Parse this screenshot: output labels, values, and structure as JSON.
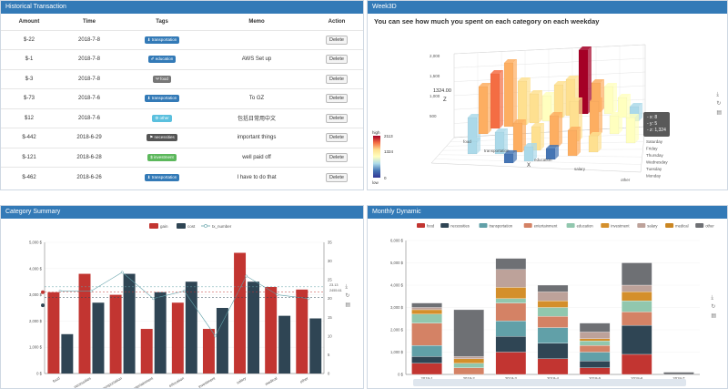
{
  "history": {
    "title": "Historical Transaction",
    "columns": [
      "Amount",
      "Time",
      "Tags",
      "Memo",
      "Action"
    ],
    "rows": [
      {
        "amount": "$-22",
        "time": "2018-7-8",
        "tag": "transportation",
        "tag_icon": "⬇",
        "tag_color": "#337ab7",
        "memo": "",
        "action": "Delete"
      },
      {
        "amount": "$-1",
        "time": "2018-7-8",
        "tag": "education",
        "tag_icon": "✐",
        "tag_color": "#337ab7",
        "memo": "AWS Set up",
        "action": "Delete"
      },
      {
        "amount": "$-3",
        "time": "2018-7-8",
        "tag": "food",
        "tag_icon": "Ψ",
        "tag_color": "#777777",
        "memo": "",
        "action": "Delete"
      },
      {
        "amount": "$-73",
        "time": "2018-7-6",
        "tag": "transportation",
        "tag_icon": "⬇",
        "tag_color": "#337ab7",
        "memo": "To GZ",
        "action": "Delete"
      },
      {
        "amount": "$12",
        "time": "2018-7-6",
        "tag": "other",
        "tag_icon": "⚙",
        "tag_color": "#5bc0de",
        "memo": "包括日常用中文",
        "action": "Delete"
      },
      {
        "amount": "$-442",
        "time": "2018-6-29",
        "tag": "necessities",
        "tag_icon": "⚑",
        "tag_color": "#555555",
        "memo": "important things",
        "action": "Delete"
      },
      {
        "amount": "$-121",
        "time": "2018-6-28",
        "tag": "investment",
        "tag_icon": "$",
        "tag_color": "#5cb85c",
        "memo": "well paid off",
        "action": "Delete"
      },
      {
        "amount": "$-462",
        "time": "2018-6-26",
        "tag": "transportation",
        "tag_icon": "⬇",
        "tag_color": "#337ab7",
        "memo": "I have to do that",
        "action": "Delete"
      }
    ]
  },
  "week3d": {
    "title": "Week3D",
    "subtitle": "You can see how much you spent on each category on each weekday",
    "visual_map": {
      "high_label": "high",
      "low_label": "low",
      "max": "2113",
      "mid": "1324",
      "min": "0"
    },
    "z_axis": {
      "label": "Z",
      "ticks": [
        "2,000",
        "1,500",
        "1,000",
        "500"
      ],
      "pointer": "1324.00"
    },
    "x_axis": {
      "label": "X",
      "categories": [
        "food",
        "transportation",
        "education",
        "salary",
        "other"
      ]
    },
    "y_axis": {
      "categories": [
        "Saturday",
        "Friday",
        "Thursday",
        "Wednesday",
        "Tuesday",
        "Monday"
      ]
    },
    "tooltip": {
      "x": "- x: 8",
      "y": "- y: 5",
      "z": "- z: 1,324"
    },
    "colors": {
      "high": "#a50026",
      "mid": "#fdae61",
      "low": "#313695",
      "light": "#ffffbf",
      "blue": "#abd9e9"
    }
  },
  "category_summary": {
    "title": "Category Summary",
    "legend": [
      "gain",
      "cost",
      "tx_number"
    ],
    "pointers": {
      "left": "",
      "right_top": "23.13",
      "right_bottom": "2455.61"
    },
    "chart_data": {
      "type": "bar",
      "categories": [
        "food",
        "necessities",
        "transportation",
        "entertainment",
        "education",
        "investment",
        "salary",
        "medical",
        "other"
      ],
      "series": [
        {
          "name": "gain",
          "color": "#c23531",
          "values": [
            3100,
            3800,
            3000,
            1700,
            2700,
            1700,
            4600,
            3300,
            3200
          ]
        },
        {
          "name": "cost",
          "color": "#2f4554",
          "values": [
            1500,
            2700,
            3800,
            3100,
            3500,
            2500,
            3500,
            2200,
            2100
          ]
        },
        {
          "name": "tx_number",
          "color": "#61a0a8",
          "type": "line",
          "values": [
            22,
            22,
            27,
            20,
            22,
            10,
            26,
            21,
            20
          ]
        }
      ],
      "y_left": {
        "ticks": [
          "0 $",
          "1,000 $",
          "2,000 $",
          "3,000 $",
          "4,000 $",
          "5,000 $"
        ],
        "max": 5000
      },
      "y_right": {
        "ticks": [
          "0",
          "5",
          "10",
          "15",
          "20",
          "25",
          "30",
          "35"
        ],
        "max": 35
      }
    }
  },
  "monthly_dynamic": {
    "title": "Monthly Dynamic",
    "chart_data": {
      "type": "bar",
      "stacked": true,
      "categories": [
        "2018-1",
        "2018-2",
        "2018-3",
        "2018-4",
        "2018-5",
        "2018-6",
        "2018-7"
      ],
      "series": [
        {
          "name": "food",
          "color": "#c23531",
          "values": [
            500,
            0,
            1000,
            700,
            300,
            900,
            0
          ]
        },
        {
          "name": "necessities",
          "color": "#2f4554",
          "values": [
            300,
            0,
            700,
            700,
            300,
            1300,
            0
          ]
        },
        {
          "name": "transportation",
          "color": "#61a0a8",
          "values": [
            500,
            0,
            700,
            700,
            400,
            0,
            0
          ]
        },
        {
          "name": "entertainment",
          "color": "#d48265",
          "values": [
            1000,
            300,
            800,
            500,
            300,
            600,
            0
          ]
        },
        {
          "name": "education",
          "color": "#91c7ae",
          "values": [
            400,
            200,
            200,
            400,
            200,
            500,
            0
          ]
        },
        {
          "name": "investment",
          "color": "#d48f2b",
          "values": [
            200,
            200,
            500,
            300,
            100,
            400,
            0
          ]
        },
        {
          "name": "salary",
          "color": "#ca8622",
          "values": [
            0,
            0,
            0,
            0,
            0,
            0,
            0
          ]
        },
        {
          "name": "medical",
          "color": "#bda29a",
          "values": [
            100,
            100,
            800,
            400,
            300,
            300,
            0
          ]
        },
        {
          "name": "other",
          "color": "#6e7074",
          "values": [
            200,
            2100,
            500,
            300,
            400,
            1000,
            100
          ]
        }
      ],
      "legend": [
        "food",
        "necessities",
        "transportation",
        "entertainment",
        "education",
        "investment",
        "salary",
        "medical",
        "other"
      ],
      "legend_colors": [
        "#c23531",
        "#2f4554",
        "#61a0a8",
        "#d48265",
        "#91c7ae",
        "#d48f2b",
        "#bda29a",
        "#ca8622",
        "#6e7074"
      ],
      "y_axis": {
        "ticks": [
          "0 $",
          "1,000 $",
          "2,000 $",
          "3,000 $",
          "4,000 $",
          "5,000 $",
          "6,000 $"
        ],
        "max": 6000
      }
    }
  },
  "toolbox_icons": [
    "download-icon",
    "restore-icon",
    "data-view-icon"
  ]
}
